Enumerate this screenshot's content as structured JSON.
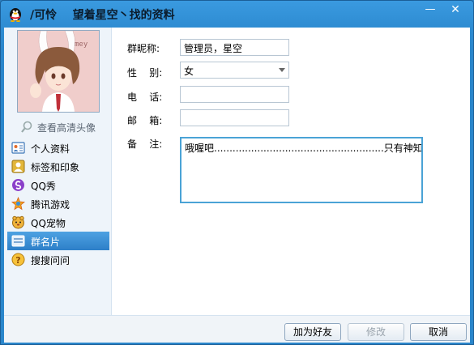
{
  "window": {
    "title": "/可怜    望着星空丶找的资料",
    "minimize_glyph": "—",
    "close_glyph": "✕"
  },
  "profile": {
    "view_hd_avatar": "查看高清头像",
    "avatar_watermark": "mey"
  },
  "sidebar": {
    "items": [
      {
        "label": "个人资料",
        "icon": "profile-card-icon"
      },
      {
        "label": "标签和印象",
        "icon": "tag-icon"
      },
      {
        "label": "QQ秀",
        "icon": "qq-show-icon"
      },
      {
        "label": "腾讯游戏",
        "icon": "games-icon"
      },
      {
        "label": "QQ宠物",
        "icon": "pet-icon"
      },
      {
        "label": "群名片",
        "icon": "group-card-icon",
        "active": true
      },
      {
        "label": "搜搜问问",
        "icon": "question-icon"
      }
    ]
  },
  "form": {
    "nickname_label": "群昵称:",
    "nickname_value": "管理员，星空",
    "gender_label": "性    别:",
    "gender_value": "女",
    "phone_label": "电    话:",
    "phone_value": "",
    "email_label": "邮    箱:",
    "email_value": "",
    "notes_label": "备    注:",
    "notes_value": "哦喔吧.......................................................只有神知道她"
  },
  "buttons": {
    "add_friend": "加为好友",
    "modify": "修改",
    "cancel": "取消"
  },
  "colors": {
    "titlebar": "#2f8dd3",
    "active_nav": "#3a91d6",
    "notes_border": "#4aa3d6"
  }
}
